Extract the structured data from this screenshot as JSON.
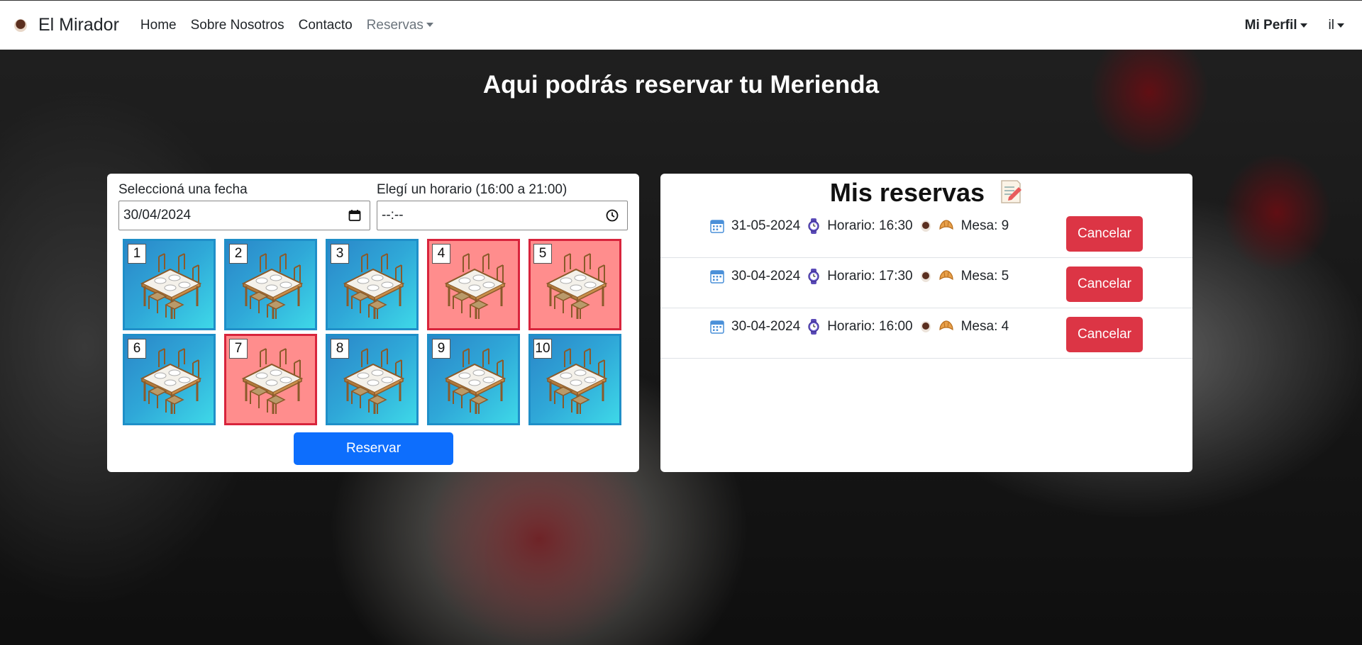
{
  "brand": {
    "name": "El Mirador",
    "icon": "coffee-cup-icon"
  },
  "nav": {
    "home": "Home",
    "about": "Sobre Nosotros",
    "contact": "Contacto",
    "reservas": "Reservas"
  },
  "user_menu": {
    "profile": "Mi Perfil",
    "user": "il"
  },
  "hero": {
    "title": "Aqui podrás reservar tu Merienda"
  },
  "form": {
    "date_label": "Seleccioná una fecha",
    "date_value": "30/04/2024",
    "time_label": "Elegí un horario (16:00 a 21:00)",
    "time_value": "--:--",
    "submit": "Reservar"
  },
  "tables": [
    {
      "number": "1",
      "status": "free"
    },
    {
      "number": "2",
      "status": "free"
    },
    {
      "number": "3",
      "status": "free"
    },
    {
      "number": "4",
      "status": "busy"
    },
    {
      "number": "5",
      "status": "busy"
    },
    {
      "number": "6",
      "status": "free"
    },
    {
      "number": "7",
      "status": "busy"
    },
    {
      "number": "8",
      "status": "free"
    },
    {
      "number": "9",
      "status": "free"
    },
    {
      "number": "10",
      "status": "free"
    }
  ],
  "reservations": {
    "title": "Mis reservas",
    "title_icon": "memo-icon",
    "items": [
      {
        "date": "31-05-2024",
        "time": "Horario: 16:30",
        "table": "Mesa: 9",
        "cancel": "Cancelar"
      },
      {
        "date": "30-04-2024",
        "time": "Horario: 17:30",
        "table": "Mesa: 5",
        "cancel": "Cancelar"
      },
      {
        "date": "30-04-2024",
        "time": "Horario: 16:00",
        "table": "Mesa: 4",
        "cancel": "Cancelar"
      }
    ]
  },
  "colors": {
    "primary": "#0d6efd",
    "danger": "#dc3545",
    "table_free": "#2fa8d8",
    "table_busy": "#ff8d8d"
  }
}
